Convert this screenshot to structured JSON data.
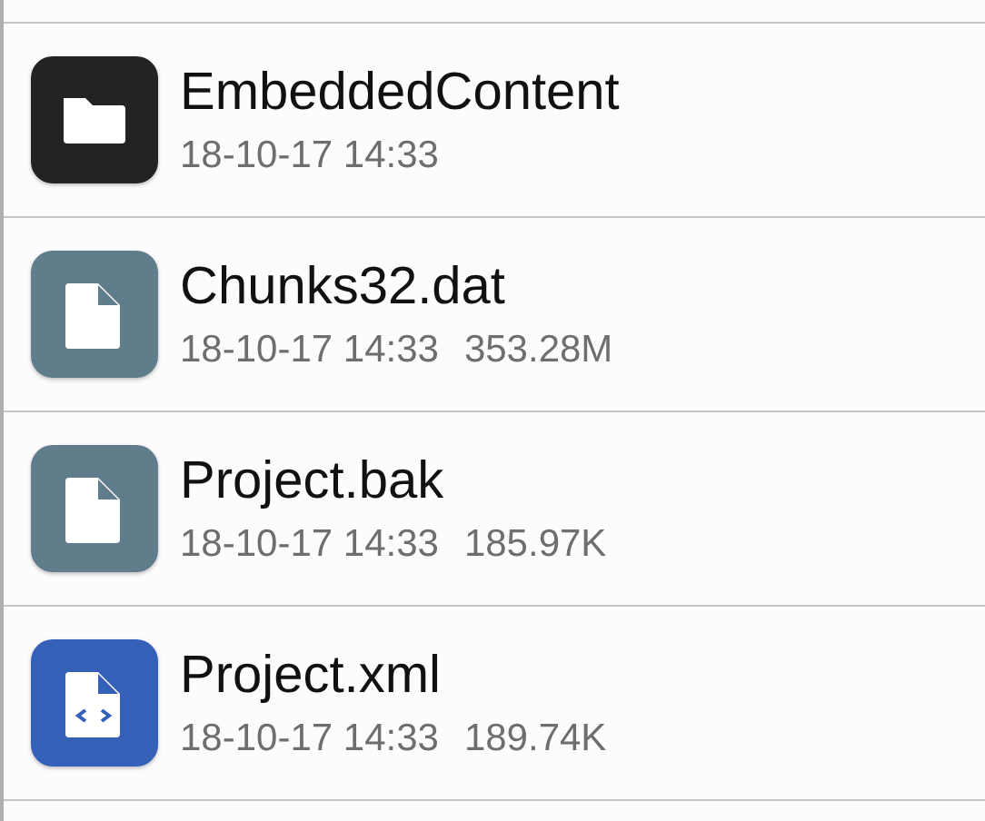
{
  "files": [
    {
      "kind": "folder",
      "name": "EmbeddedContent",
      "date": "18-10-17 14:33"
    },
    {
      "kind": "file",
      "name": "Chunks32.dat",
      "date": "18-10-17 14:33",
      "size": "353.28M"
    },
    {
      "kind": "file",
      "name": "Project.bak",
      "date": "18-10-17 14:33",
      "size": "185.97K"
    },
    {
      "kind": "code",
      "name": "Project.xml",
      "date": "18-10-17 14:33",
      "size": "189.74K"
    }
  ]
}
